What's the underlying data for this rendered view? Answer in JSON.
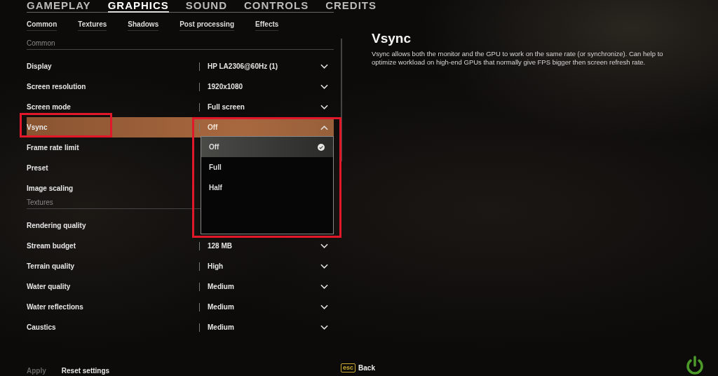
{
  "main_tabs": [
    {
      "label": "GAMEPLAY",
      "selected": false
    },
    {
      "label": "GRAPHICS",
      "selected": true
    },
    {
      "label": "SOUND",
      "selected": false
    },
    {
      "label": "CONTROLS",
      "selected": false
    },
    {
      "label": "CREDITS",
      "selected": false
    }
  ],
  "sub_tabs": [
    {
      "label": "Common"
    },
    {
      "label": "Textures"
    },
    {
      "label": "Shadows"
    },
    {
      "label": "Post processing"
    },
    {
      "label": "Effects"
    }
  ],
  "sections": [
    {
      "title": "Common",
      "rows": [
        {
          "label": "Display",
          "value": "HP LA2306@60Hz (1)",
          "selected": false,
          "expanded": false,
          "highlighted": false
        },
        {
          "label": "Screen resolution",
          "value": "1920x1080",
          "selected": false,
          "expanded": false,
          "highlighted": false
        },
        {
          "label": "Screen mode",
          "value": "Full screen",
          "selected": false,
          "expanded": false,
          "highlighted": false
        },
        {
          "label": "Vsync",
          "value": "Off",
          "selected": true,
          "expanded": true,
          "highlighted": true,
          "options": [
            {
              "label": "Off",
              "selected": true
            },
            {
              "label": "Full",
              "selected": false
            },
            {
              "label": "Half",
              "selected": false
            }
          ]
        },
        {
          "label": "Frame rate limit",
          "selected": false,
          "highlighted": false
        },
        {
          "label": "Preset",
          "selected": false,
          "highlighted": false
        },
        {
          "label": "Image scaling",
          "selected": false,
          "highlighted": false
        }
      ]
    },
    {
      "title": "Textures",
      "rows": [
        {
          "label": "Rendering quality",
          "selected": false,
          "highlighted": false
        },
        {
          "label": "Stream budget",
          "value": "128 MB",
          "selected": false,
          "expanded": false,
          "highlighted": false
        },
        {
          "label": "Terrain quality",
          "value": "High",
          "selected": false,
          "expanded": false,
          "highlighted": false
        },
        {
          "label": "Water quality",
          "value": "Medium",
          "selected": false,
          "expanded": false,
          "highlighted": false
        },
        {
          "label": "Water reflections",
          "value": "Medium",
          "selected": false,
          "expanded": false,
          "highlighted": false
        },
        {
          "label": "Caustics",
          "value": "Medium",
          "selected": false,
          "expanded": false,
          "highlighted": false
        }
      ]
    }
  ],
  "footer_buttons": [
    {
      "label": "Apply",
      "disabled": true
    },
    {
      "label": "Reset settings",
      "disabled": false
    }
  ],
  "info": {
    "title": "Vsync",
    "description": "Vsync allows both the monitor and the GPU to work on the same rate (or synchronize). Can help to optimize workload on high-end GPUs that normally give FPS bigger then screen refresh rate."
  },
  "back": {
    "key": "esc",
    "label": "Back"
  }
}
